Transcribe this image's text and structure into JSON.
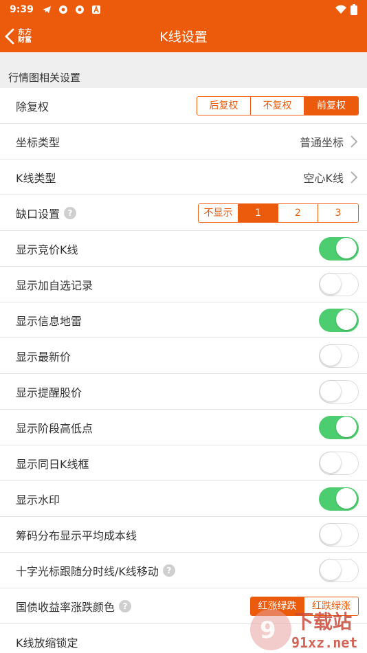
{
  "statusbar": {
    "time": "9:39"
  },
  "navbar": {
    "title": "K线设置",
    "logo_line1": "东方",
    "logo_line2": "财富"
  },
  "section": {
    "title": "行情图相关设置"
  },
  "rows": {
    "fuquan": {
      "label": "除复权",
      "options": [
        "后复权",
        "不复权",
        "前复权"
      ],
      "selected": "前复权"
    },
    "axis": {
      "label": "坐标类型",
      "value": "普通坐标"
    },
    "ktype": {
      "label": "K线类型",
      "value": "空心K线"
    },
    "gap": {
      "label": "缺口设置",
      "options": [
        "不显示",
        "1",
        "2",
        "3"
      ],
      "selected": "1"
    },
    "toggles": [
      {
        "label": "显示竞价K线",
        "on": true
      },
      {
        "label": "显示加自选记录",
        "on": false
      },
      {
        "label": "显示信息地雷",
        "on": true
      },
      {
        "label": "显示最新价",
        "on": false
      },
      {
        "label": "显示提醒股价",
        "on": false
      },
      {
        "label": "显示阶段高低点",
        "on": true
      },
      {
        "label": "显示同日K线框",
        "on": false
      },
      {
        "label": "显示水印",
        "on": true
      },
      {
        "label": "筹码分布显示平均成本线",
        "on": false
      },
      {
        "label": "十字光标跟随分时线/K线移动",
        "on": false
      }
    ],
    "bond": {
      "label": "国债收益率涨跌颜色",
      "options": [
        "红涨绿跌",
        "红跌绿涨"
      ],
      "selected": "红涨绿跌"
    },
    "lock": {
      "label": "K线放缩锁定"
    }
  },
  "watermark": {
    "text1": "下载站",
    "text2": "91xz.net"
  },
  "colors": {
    "accent": "#ec5a0b",
    "toggle_on": "#4ccd6f"
  }
}
